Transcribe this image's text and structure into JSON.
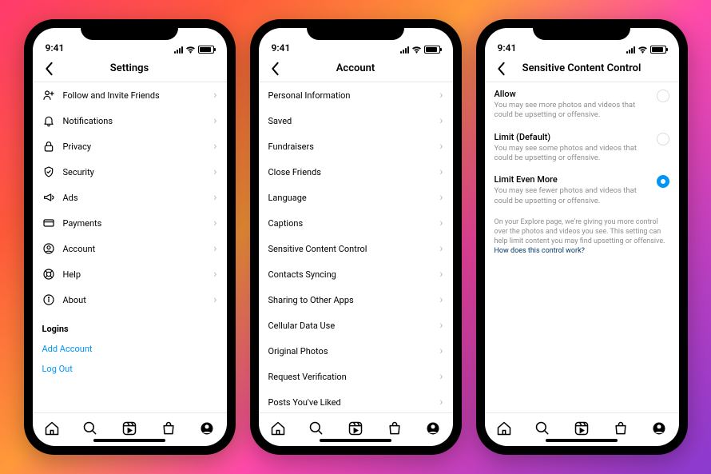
{
  "status": {
    "time": "9:41"
  },
  "screens": [
    {
      "title": "Settings",
      "items": [
        {
          "icon": "person-plus",
          "label": "Follow and Invite Friends"
        },
        {
          "icon": "bell",
          "label": "Notifications"
        },
        {
          "icon": "lock",
          "label": "Privacy"
        },
        {
          "icon": "shield",
          "label": "Security"
        },
        {
          "icon": "megaphone",
          "label": "Ads"
        },
        {
          "icon": "card",
          "label": "Payments"
        },
        {
          "icon": "person",
          "label": "Account"
        },
        {
          "icon": "life-ring",
          "label": "Help"
        },
        {
          "icon": "info",
          "label": "About"
        }
      ],
      "logins_header": "Logins",
      "logins": [
        {
          "label": "Add Account"
        },
        {
          "label": "Log Out"
        }
      ]
    },
    {
      "title": "Account",
      "items": [
        {
          "label": "Personal Information"
        },
        {
          "label": "Saved"
        },
        {
          "label": "Fundraisers"
        },
        {
          "label": "Close Friends"
        },
        {
          "label": "Language"
        },
        {
          "label": "Captions"
        },
        {
          "label": "Sensitive Content Control"
        },
        {
          "label": "Contacts Syncing"
        },
        {
          "label": "Sharing to Other Apps"
        },
        {
          "label": "Cellular Data Use"
        },
        {
          "label": "Original Photos"
        },
        {
          "label": "Request Verification"
        },
        {
          "label": "Posts You've Liked"
        }
      ]
    },
    {
      "title": "Sensitive Content Control",
      "options": [
        {
          "title": "Allow",
          "desc": "You may see more photos and videos that could be upsetting or offensive.",
          "selected": false
        },
        {
          "title": "Limit (Default)",
          "desc": "You may see some photos and videos that could be upsetting or offensive.",
          "selected": false
        },
        {
          "title": "Limit Even More",
          "desc": "You may see fewer photos and videos that could be upsetting or offensive.",
          "selected": true
        }
      ],
      "info": "On your Explore page, we're giving you more control over the photos and videos you see. This setting can help limit content you may find upsetting or offensive.",
      "info_link": "How does this control work?"
    }
  ]
}
